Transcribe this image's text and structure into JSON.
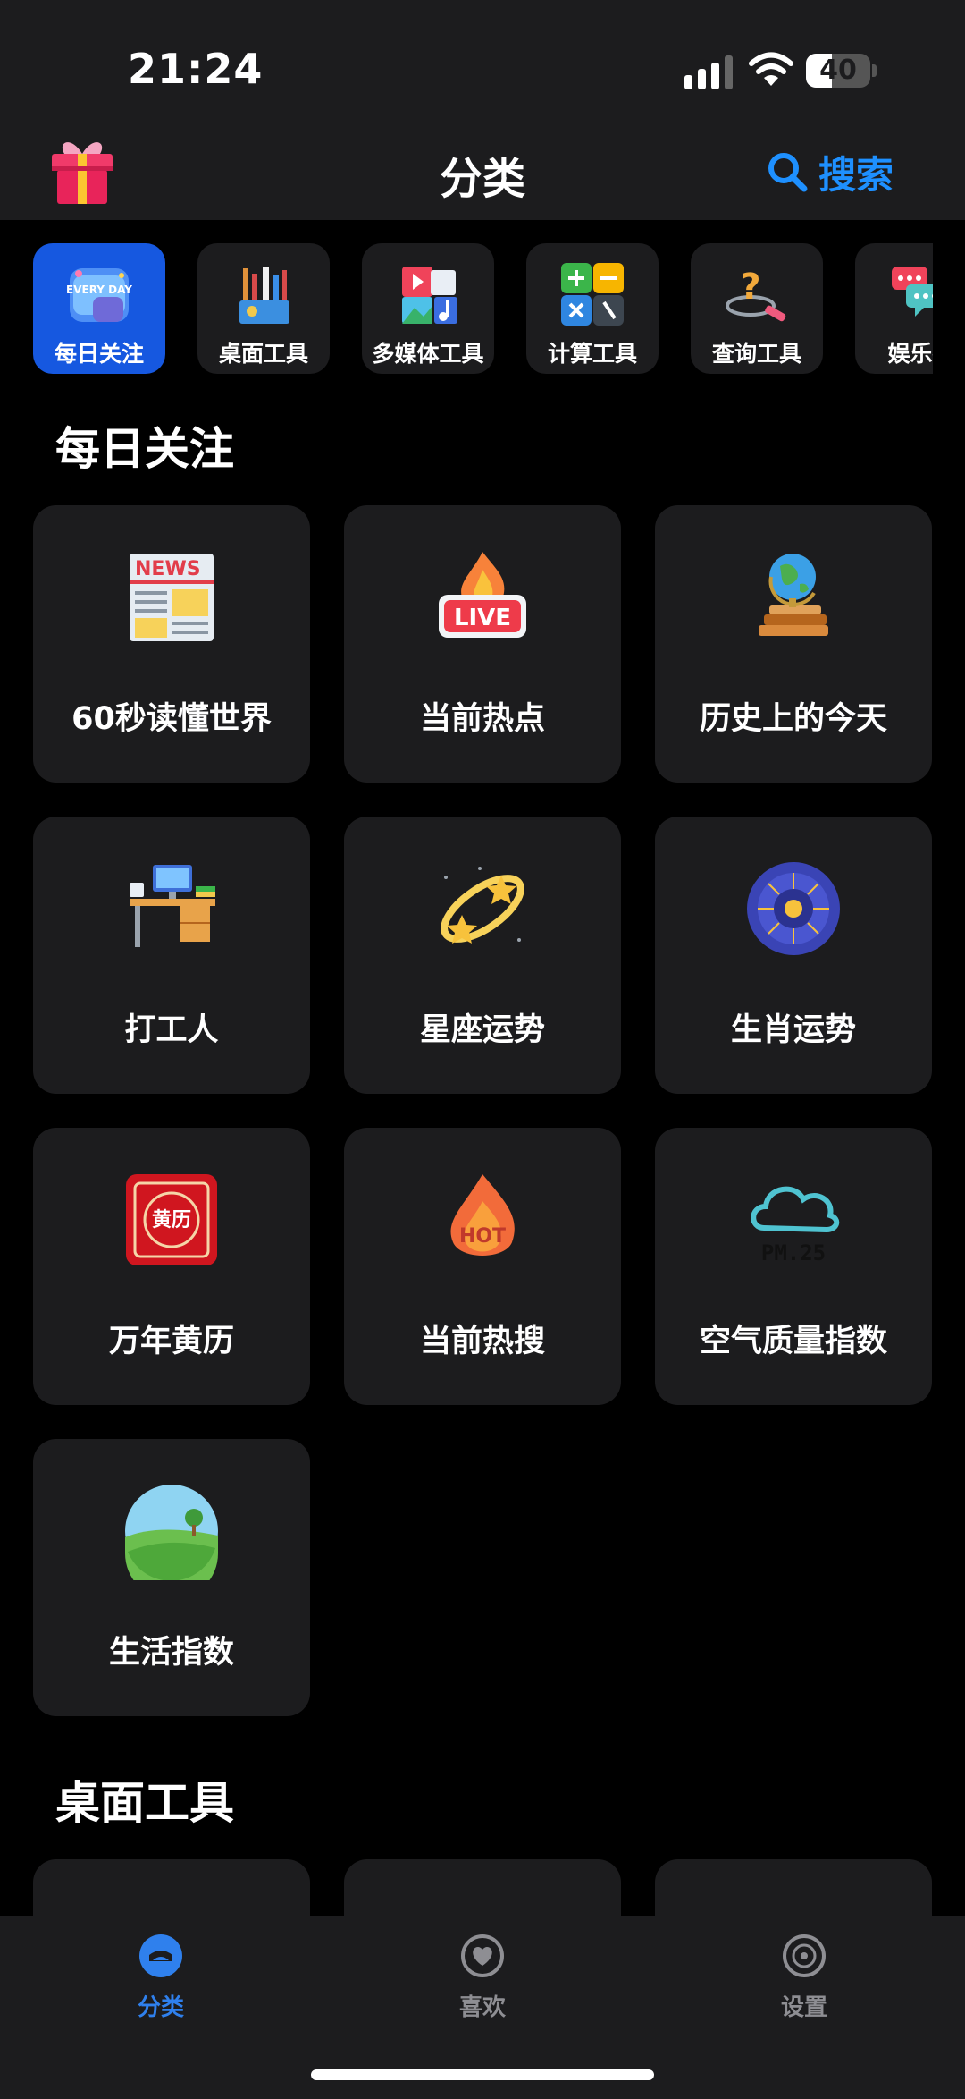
{
  "status_bar": {
    "time": "21:24",
    "battery": "40",
    "battery_fraction": 0.4
  },
  "header": {
    "title": "分类",
    "search_label": "搜索"
  },
  "categories": [
    {
      "label": "每日关注",
      "icon": "everyday-icon",
      "active": true
    },
    {
      "label": "桌面工具",
      "icon": "desk-tools-icon",
      "active": false
    },
    {
      "label": "多媒体工具",
      "icon": "multimedia-icon",
      "active": false
    },
    {
      "label": "计算工具",
      "icon": "calculator-icon",
      "active": false
    },
    {
      "label": "查询工具",
      "icon": "query-icon",
      "active": false
    },
    {
      "label": "娱乐社",
      "icon": "chat-icon",
      "active": false
    }
  ],
  "sections": [
    {
      "title": "每日关注",
      "items": [
        {
          "label": "60秒读懂世界",
          "icon": "news-icon"
        },
        {
          "label": "当前热点",
          "icon": "live-fire-icon"
        },
        {
          "label": "历史上的今天",
          "icon": "globe-books-icon"
        },
        {
          "label": "打工人",
          "icon": "office-desk-icon"
        },
        {
          "label": "星座运势",
          "icon": "shooting-stars-icon"
        },
        {
          "label": "生肖运势",
          "icon": "zodiac-wheel-icon"
        },
        {
          "label": "万年黄历",
          "icon": "almanac-icon"
        },
        {
          "label": "当前热搜",
          "icon": "hot-fire-icon"
        },
        {
          "label": "空气质量指数",
          "icon": "pm25-cloud-icon"
        },
        {
          "label": "生活指数",
          "icon": "landscape-icon"
        }
      ]
    },
    {
      "title": "桌面工具"
    }
  ],
  "icon_texts": {
    "everyday": "EVERY DAY",
    "news": "NEWS",
    "live": "LIVE",
    "hot": "HOT",
    "almanac": "黄历",
    "pm": "PM.25"
  },
  "tabs": [
    {
      "label": "分类",
      "icon": "category-icon",
      "active": true
    },
    {
      "label": "喜欢",
      "icon": "heart-icon",
      "active": false
    },
    {
      "label": "设置",
      "icon": "settings-icon",
      "active": false
    }
  ],
  "colors": {
    "accent": "#1e90ff",
    "active_category": "#1658e0",
    "tile_bg": "#1c1c1e",
    "tab_active": "#2f80ed",
    "tab_inactive": "#8e8e93"
  }
}
